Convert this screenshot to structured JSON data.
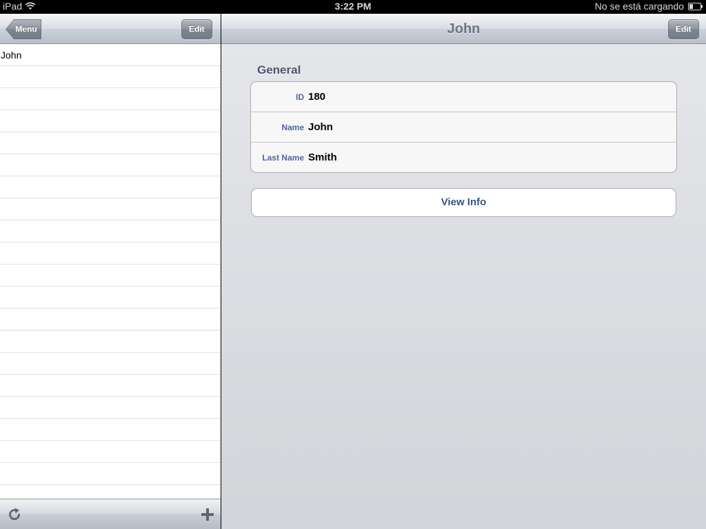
{
  "status_bar": {
    "carrier": "iPad",
    "time": "3:22 PM",
    "battery_status": "No se está cargando"
  },
  "master": {
    "back_button_label": "Menu",
    "edit_button_label": "Edit",
    "rows": [
      "John",
      "",
      "",
      "",
      "",
      "",
      "",
      "",
      "",
      "",
      "",
      "",
      "",
      "",
      "",
      "",
      "",
      "",
      "",
      "",
      ""
    ],
    "toolbar": {
      "left_icon": "refresh-icon",
      "right_icon": "plus-icon"
    }
  },
  "detail": {
    "title": "John",
    "edit_button_label": "Edit",
    "section_header": "General",
    "fields": [
      {
        "label": "ID",
        "value": "180"
      },
      {
        "label": "Name",
        "value": "John"
      },
      {
        "label": "Last Name",
        "value": "Smith"
      }
    ],
    "view_info_label": "View Info"
  },
  "colors": {
    "label_blue": "#52669a",
    "button_text_blue": "#385487",
    "section_header": "#4c566c"
  }
}
